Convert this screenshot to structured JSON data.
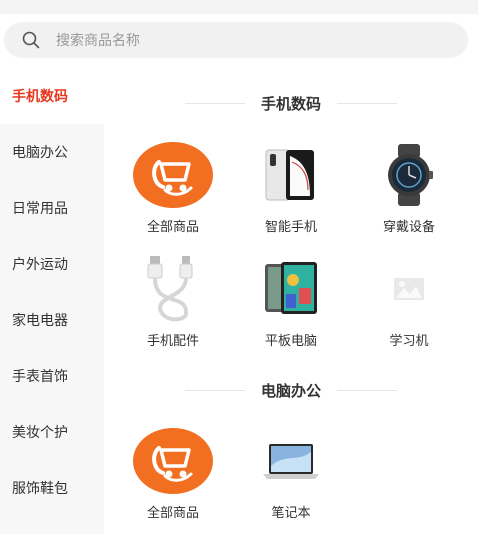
{
  "search": {
    "placeholder": "搜索商品名称"
  },
  "sidebar": {
    "items": [
      {
        "label": "手机数码"
      },
      {
        "label": "电脑办公"
      },
      {
        "label": "日常用品"
      },
      {
        "label": "户外运动"
      },
      {
        "label": "家电电器"
      },
      {
        "label": "手表首饰"
      },
      {
        "label": "美妆个护"
      },
      {
        "label": "服饰鞋包"
      }
    ]
  },
  "sections": [
    {
      "title": "手机数码",
      "items": [
        {
          "label": "全部商品",
          "icon": "all-products-icon"
        },
        {
          "label": "智能手机",
          "icon": "smartphone-icon"
        },
        {
          "label": "穿戴设备",
          "icon": "smartwatch-icon"
        },
        {
          "label": "手机配件",
          "icon": "usb-cable-icon"
        },
        {
          "label": "平板电脑",
          "icon": "tablet-icon"
        },
        {
          "label": "学习机",
          "icon": "image-placeholder-icon"
        }
      ]
    },
    {
      "title": "电脑办公",
      "items": [
        {
          "label": "全部商品",
          "icon": "all-products-icon"
        },
        {
          "label": "笔记本",
          "icon": "laptop-icon"
        }
      ]
    }
  ],
  "colors": {
    "accent": "#e8361d",
    "brand_orange": "#f26f21",
    "sidebar_bg": "#f7f7f7"
  }
}
